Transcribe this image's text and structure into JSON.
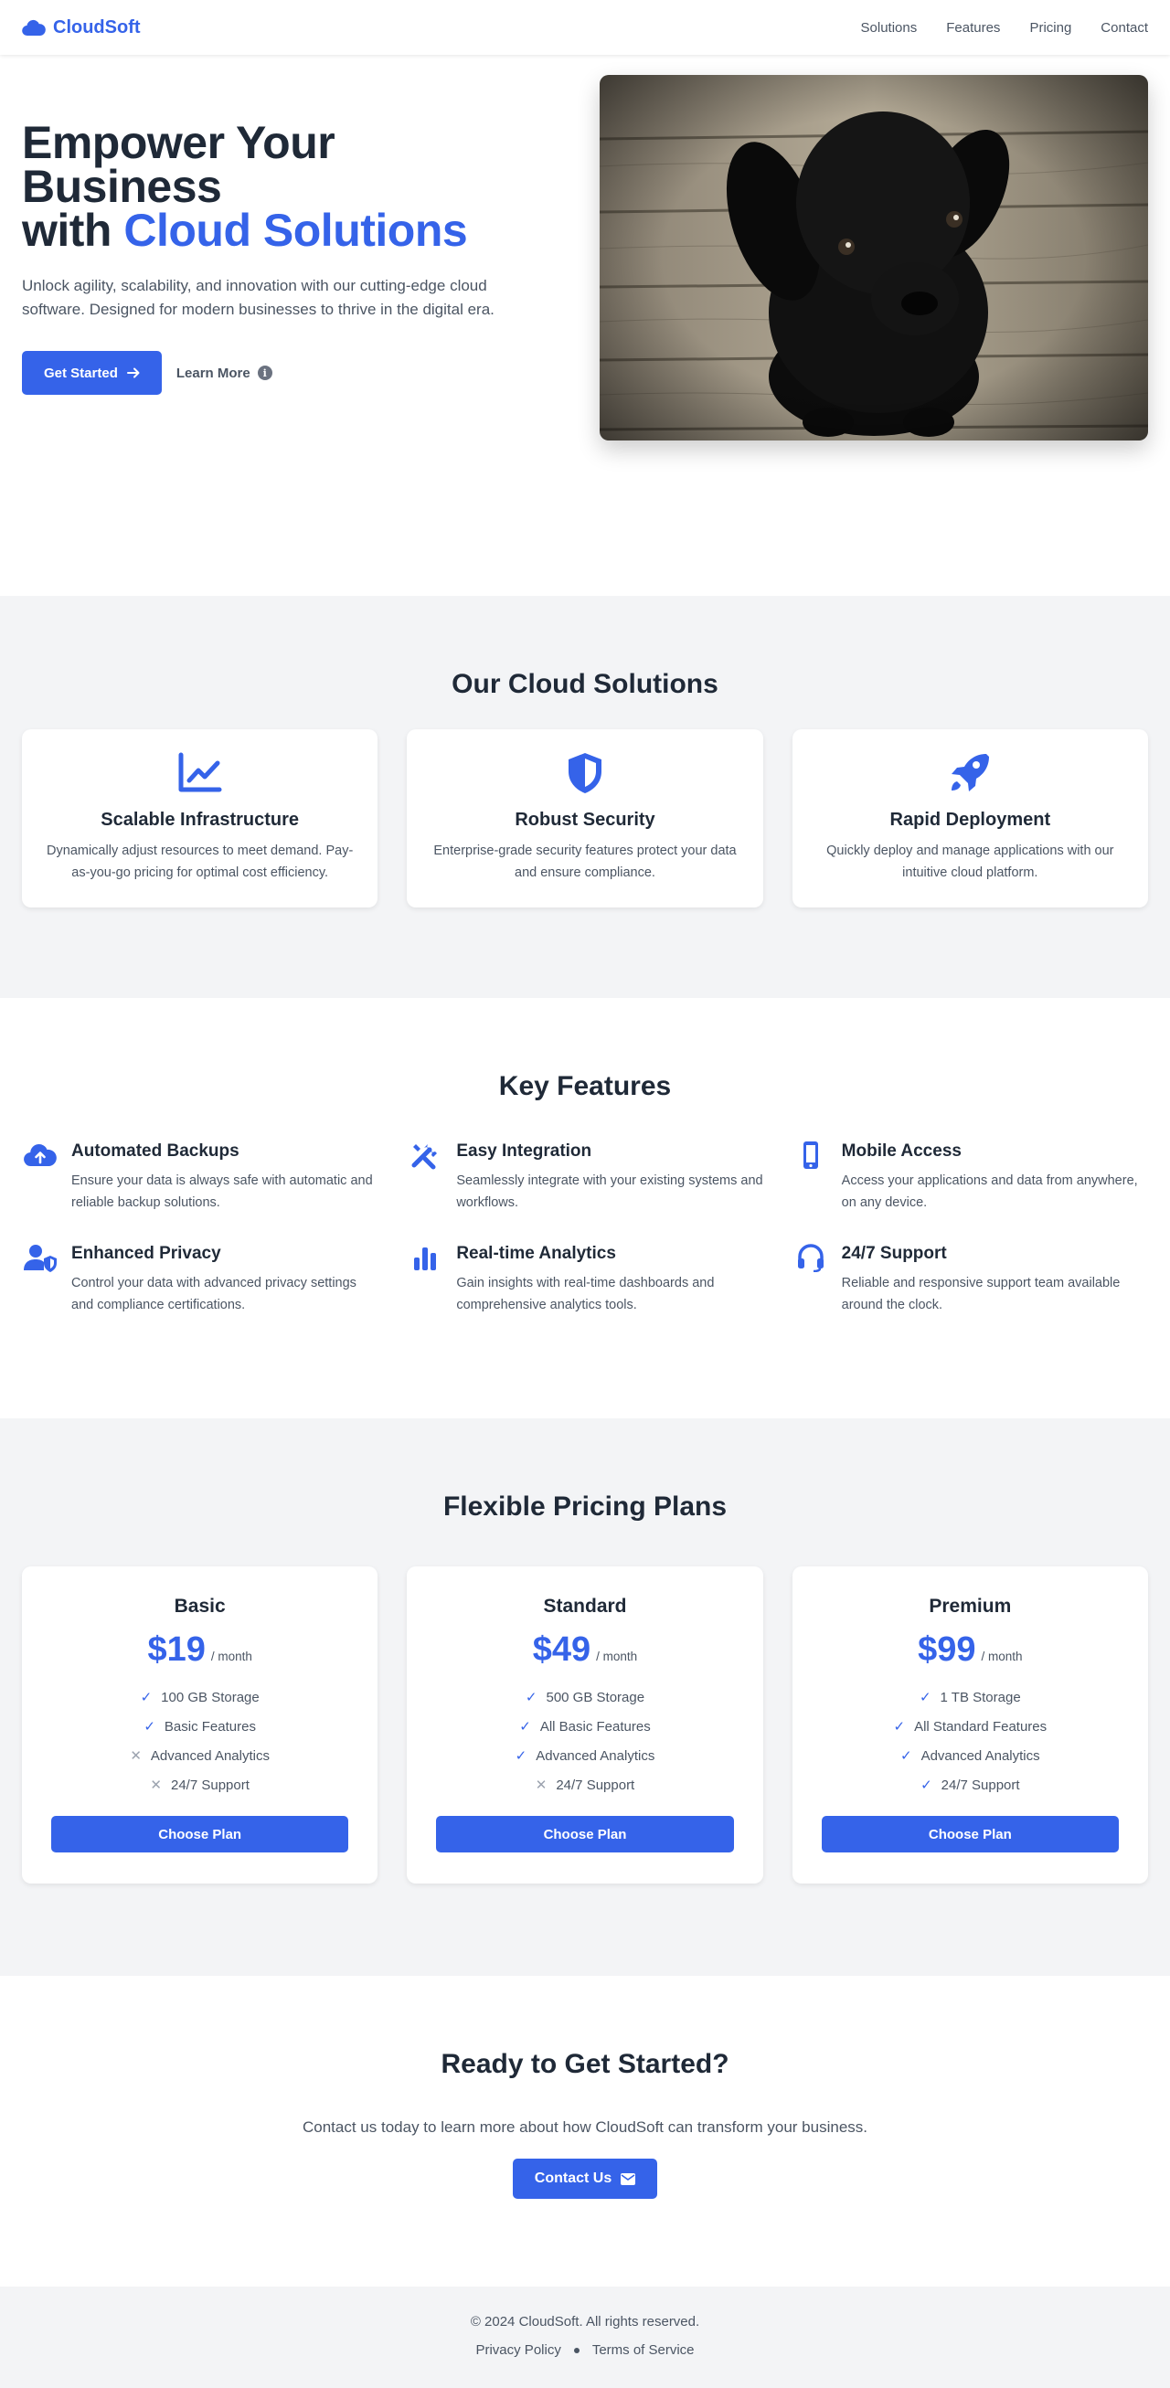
{
  "brand": {
    "name": "CloudSoft",
    "color": "#3563e9",
    "logo_icon": "cloud-icon"
  },
  "nav": {
    "links": [
      "Solutions",
      "Features",
      "Pricing",
      "Contact"
    ]
  },
  "hero": {
    "title_line1": "Empower Your Business",
    "title_prefix": "with",
    "title_accent": "Cloud Solutions",
    "subtitle": "Unlock agility, scalability, and innovation with our cutting-edge cloud software. Designed for modern businesses to thrive in the digital era.",
    "primary_cta": "Get Started",
    "secondary_cta": "Learn More",
    "image_subject": "black puppy on wooden floor"
  },
  "solutions": {
    "title": "Our Cloud Solutions",
    "cards": [
      {
        "icon": "chart-line-icon",
        "title": "Scalable Infrastructure",
        "text": "Dynamically adjust resources to meet demand. Pay-as-you-go pricing for optimal cost efficiency."
      },
      {
        "icon": "shield-icon",
        "title": "Robust Security",
        "text": "Enterprise-grade security features protect your data and ensure compliance."
      },
      {
        "icon": "rocket-icon",
        "title": "Rapid Deployment",
        "text": "Quickly deploy and manage applications with our intuitive cloud platform."
      }
    ]
  },
  "features": {
    "title": "Key Features",
    "items": [
      {
        "icon": "cloud-upload-icon",
        "title": "Automated Backups",
        "text": "Ensure your data is always safe with automatic and reliable backup solutions."
      },
      {
        "icon": "tools-icon",
        "title": "Easy Integration",
        "text": "Seamlessly integrate with your existing systems and workflows."
      },
      {
        "icon": "mobile-icon",
        "title": "Mobile Access",
        "text": "Access your applications and data from anywhere, on any device."
      },
      {
        "icon": "user-shield-icon",
        "title": "Enhanced Privacy",
        "text": "Control your data with advanced privacy settings and compliance certifications."
      },
      {
        "icon": "bar-chart-icon",
        "title": "Real-time Analytics",
        "text": "Gain insights with real-time dashboards and comprehensive analytics tools."
      },
      {
        "icon": "headset-icon",
        "title": "24/7 Support",
        "text": "Reliable and responsive support team available around the clock."
      }
    ]
  },
  "pricing": {
    "title": "Flexible Pricing Plans",
    "per_label": "/ month",
    "button_label": "Choose Plan",
    "plans": [
      {
        "name": "Basic",
        "price": "$19",
        "features": [
          {
            "text": "100 GB Storage",
            "included": true
          },
          {
            "text": "Basic Features",
            "included": true
          },
          {
            "text": "Advanced Analytics",
            "included": false
          },
          {
            "text": "24/7 Support",
            "included": false
          }
        ]
      },
      {
        "name": "Standard",
        "price": "$49",
        "features": [
          {
            "text": "500 GB Storage",
            "included": true
          },
          {
            "text": "All Basic Features",
            "included": true
          },
          {
            "text": "Advanced Analytics",
            "included": true
          },
          {
            "text": "24/7 Support",
            "included": false
          }
        ]
      },
      {
        "name": "Premium",
        "price": "$99",
        "features": [
          {
            "text": "1 TB Storage",
            "included": true
          },
          {
            "text": "All Standard Features",
            "included": true
          },
          {
            "text": "Advanced Analytics",
            "included": true
          },
          {
            "text": "24/7 Support",
            "included": true
          }
        ]
      }
    ]
  },
  "cta": {
    "title": "Ready to Get Started?",
    "text": "Contact us today to learn more about how CloudSoft can transform your business.",
    "button": "Contact Us"
  },
  "footer": {
    "copyright": "© 2024 CloudSoft. All rights reserved.",
    "links": [
      "Privacy Policy",
      "Terms of Service"
    ]
  }
}
